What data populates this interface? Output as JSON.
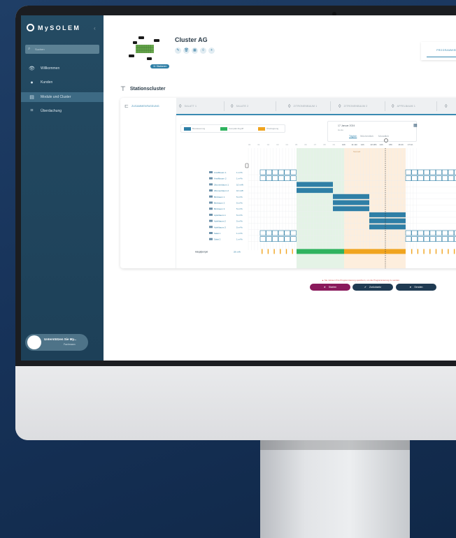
{
  "colors": {
    "sidebar": "#244b63",
    "accent": "#3a8ab2",
    "bar": "#2f7fa6",
    "green": "#2fb35f",
    "orange": "#f0a41f",
    "danger": "#8a1a5c"
  },
  "brand": {
    "logo_icon": "sun-logo-icon",
    "name": "MySOLEM"
  },
  "sidebar": {
    "search_placeholder": "Suchen",
    "items": [
      {
        "label": "Willkommen",
        "icon": "eye-icon"
      },
      {
        "label": "Kunden",
        "icon": "users-icon"
      },
      {
        "label": "Module und Cluster",
        "icon": "modules-icon",
        "active": true
      },
      {
        "label": "Überdachung",
        "icon": "frame-icon"
      }
    ],
    "support": {
      "title": "Unterstützen Sie My...",
      "subtitle": "Fachmann"
    }
  },
  "header": {
    "title": "Cluster AG",
    "badge": "11 Stationen",
    "tools": [
      "edit-icon",
      "delete-icon",
      "list-icon",
      "drop-icon",
      "add-icon"
    ],
    "program_tab": "PROGRAMMIERUN"
  },
  "section": {
    "title": "Stationscluster"
  },
  "tabs": [
    {
      "label": "ZUSAMMENFASSUNG",
      "icon": "summary-icon",
      "active": true
    },
    {
      "label": "SALATT 1",
      "icon": "drop-icon"
    },
    {
      "label": "SALATE 2",
      "icon": "drop-icon"
    },
    {
      "label": "ZITRONENBAUM 1",
      "icon": "drop-icon"
    },
    {
      "label": "ZITRONENBAUM 2",
      "icon": "drop-icon"
    },
    {
      "label": "APFELBAUM 1",
      "icon": "drop-icon"
    },
    {
      "label": "",
      "icon": "drop-icon"
    }
  ],
  "legend": [
    {
      "label": "Bewässerung",
      "color": "#2f7fa6"
    },
    {
      "label": "Kompakt Zugriff",
      "color": "#2fb35f"
    },
    {
      "label": "Überlappung",
      "color": "#f0a41f"
    }
  ],
  "datebox": {
    "date": "17 Januar 2024",
    "sub": "Heute",
    "tabs": [
      "Täglich",
      "Wöchentlich",
      "Monatlich"
    ],
    "active_tab": "Täglich"
  },
  "chart": {
    "now_label": "Sonnelt",
    "time_labels": [
      "00",
      "01",
      "02",
      "03",
      "04",
      "05",
      "06",
      "07",
      "08",
      "09",
      "10h",
      "11:11h",
      "12h",
      "13:18h",
      "14h",
      "15h",
      "16:1h",
      "17:1h"
    ],
    "rows": [
      {
        "name": "Ansiftbaum 1",
        "flow": "1 m³/h"
      },
      {
        "name": "Ansiftbaum 2",
        "flow": "1 m³/h"
      },
      {
        "name": "Zitronenbaum 1",
        "flow": "10 m³/h"
      },
      {
        "name": "Zitronenbaum 2",
        "flow": "10 m³/h"
      },
      {
        "name": "Birnbaum 1",
        "flow": "5 m³/h"
      },
      {
        "name": "Birnbaum 2",
        "flow": "5 m³/h"
      },
      {
        "name": "Birnbaum 3",
        "flow": "5 m³/h"
      },
      {
        "name": "Apfelbaum 1",
        "flow": "5 m³/h"
      },
      {
        "name": "Apfelbaum 2",
        "flow": "5 m³/h"
      },
      {
        "name": "Apfelbaum 3",
        "flow": "5 m³/h"
      },
      {
        "name": "Salat 1",
        "flow": "1 m³/h"
      },
      {
        "name": "Salat 2",
        "flow": "1 m³/h"
      }
    ],
    "pump": {
      "name": "Hauptpumpe",
      "flow": "28 m³/h"
    }
  },
  "actions": {
    "warning": "Sie müssen Ihre Programmierung speichern, um die Programmierung zu senden.",
    "start": "Starten",
    "back": "Zurücksetz",
    "send": "Senden"
  }
}
